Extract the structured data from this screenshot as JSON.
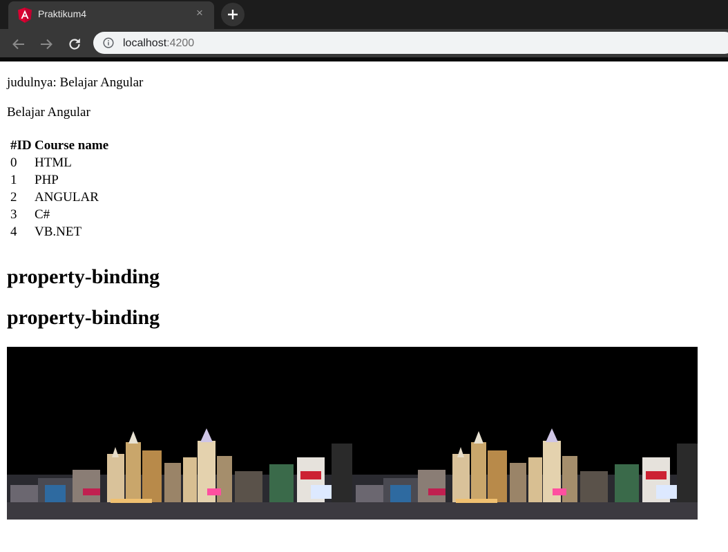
{
  "browser": {
    "tab_title": "Praktikum4",
    "url_host": "localhost",
    "url_port": ":4200"
  },
  "page": {
    "title_line": "judulnya: Belajar Angular",
    "subtitle_line": "Belajar Angular",
    "table": {
      "headers": [
        "#ID",
        "Course name"
      ],
      "rows": [
        {
          "id": "0",
          "name": "HTML"
        },
        {
          "id": "1",
          "name": "PHP"
        },
        {
          "id": "2",
          "name": "ANGULAR"
        },
        {
          "id": "3",
          "name": "C#"
        },
        {
          "id": "4",
          "name": "VB.NET"
        }
      ]
    },
    "heading_1": "property-binding",
    "heading_2": "property-binding"
  },
  "colors": {
    "angular_red": "#dd0031",
    "tabstrip": "#1c1c1c",
    "toolbar": "#383838"
  },
  "icons": {
    "tab_favicon": "angular-logo-icon",
    "tab_close": "close-icon",
    "new_tab": "plus-icon",
    "back": "arrow-left-icon",
    "forward": "arrow-right-icon",
    "reload": "reload-icon",
    "site_info": "info-icon"
  }
}
